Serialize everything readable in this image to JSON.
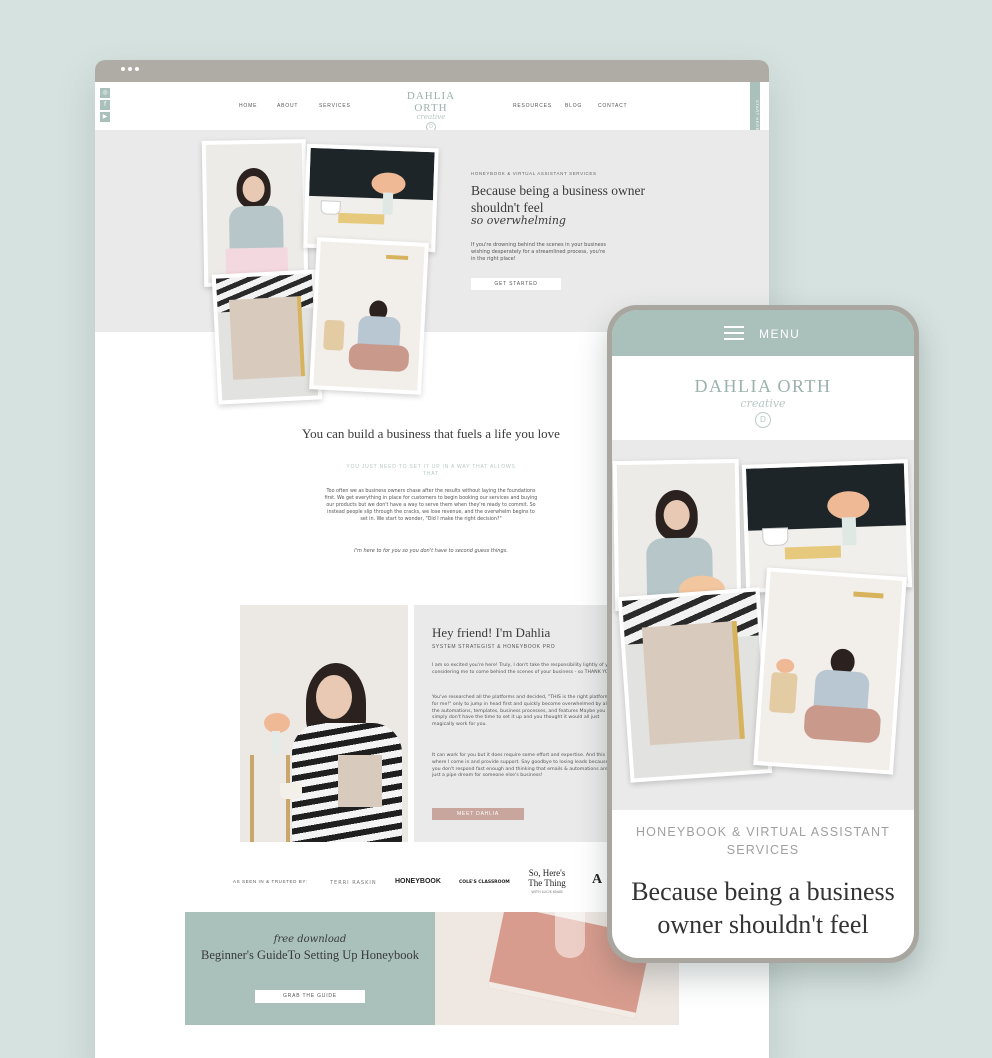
{
  "desktop": {
    "nav": {
      "links_left": [
        "HOME",
        "ABOUT",
        "SERVICES"
      ],
      "links_right": [
        "RESOURCES",
        "BLOG",
        "CONTACT"
      ],
      "logo_name": "DAHLIA ORTH",
      "logo_script": "creative",
      "side_tab": "START HERE"
    },
    "hero": {
      "eyebrow": "HONEYBOOK & VIRTUAL ASSISTANT SERVICES",
      "title": "Because being a business owner shouldn't feel",
      "script": "so overwhelming",
      "body": "If you're drowning behind the scenes in your business wishing desperately for a streamlined process, you're in the right place!",
      "cta": "GET STARTED"
    },
    "intro": {
      "title": "You can build a business that fuels a life you love",
      "subtitle": "YOU JUST NEED TO SET IT UP IN A WAY THAT ALLOWS THAT",
      "body": "Too often we as business owners chase after the results without laying the foundations first. We get everything in place for customers to begin booking our services and buying our products but we don't have a way to serve them when they're ready to commit. So instead people slip through the cracks, we lose revenue, and the overwhelm begins to set in. We start to wonder, \"Did I make the right decision?\"",
      "quote": "I'm here to for you so you don't have to second guess things."
    },
    "about": {
      "title": "Hey friend! I'm Dahlia",
      "subtitle": "SYSTEM STRATEGIST & HONEYBOOK PRO",
      "p1": "I am so excited you're here! Truly, I don't take the responsibility lightly of you considering me to come behind the scenes of your business - so THANK YOU!",
      "p2": "You've researched all the platforms and decided, \"THIS is the right platform for me!\" only to jump in head first and quickly become overwhelmed by all the automations, templates, business processes, and features Maybe you simply don't have the time to set it up and you thought it would all just magically work for you.",
      "p3": "It can work for you but it does require some effort and expertise. And this is where I come in and provide support. Say goodbye to losing leads because you don't respond fast enough and thinking that emails & automations are just a pipe dream for someone else's business!",
      "cta": "MEET DAHLIA"
    },
    "logos": {
      "label": "AS SEEN IN & TRUSTED BY:",
      "items": [
        "TERRI RASKIN",
        "HONEYBOOK",
        "COLE'S CLASSROOM",
        "So, Here's The Thing",
        "WITH LUCIE KNAB",
        "A"
      ]
    },
    "download": {
      "script": "free download",
      "title": "Beginner's GuideTo Setting Up Honeybook",
      "cta": "GRAB THE GUIDE"
    }
  },
  "mobile": {
    "menu_label": "MENU",
    "logo_name": "DAHLIA ORTH",
    "logo_script": "creative",
    "eyebrow": "HONEYBOOK & VIRTUAL ASSISTANT SERVICES",
    "title": "Because being a business owner shouldn't feel"
  },
  "colors": {
    "background": "#d6e2df",
    "sage": "#a9c0bb",
    "rose": "#c8a69d",
    "frame": "#aeaca5"
  }
}
